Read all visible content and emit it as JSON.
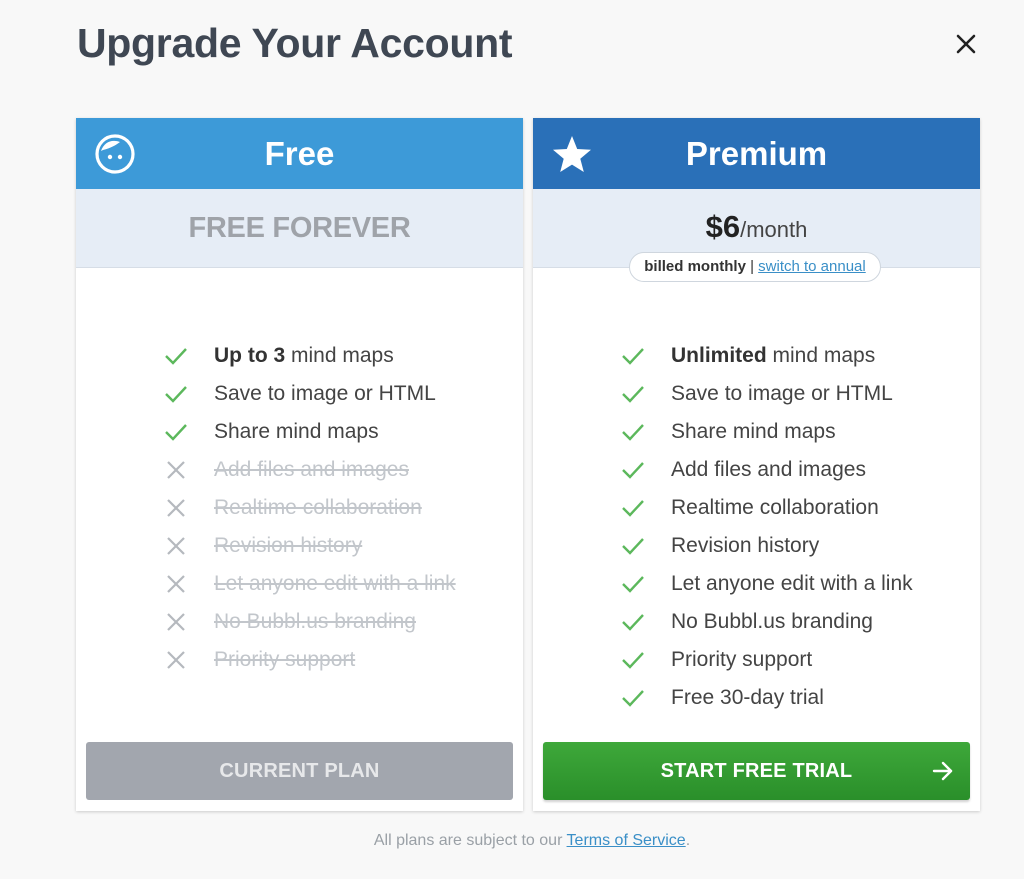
{
  "dialog": {
    "title": "Upgrade Your Account",
    "close_icon": "close-icon"
  },
  "plans": {
    "free": {
      "name": "Free",
      "icon": "face-icon",
      "header_color": "#3d9ad8",
      "price_text": "FREE FOREVER",
      "features": [
        {
          "pre": "",
          "strong": "Up to 3",
          "post": " mind maps",
          "enabled": true
        },
        {
          "pre": "Save to image or HTML",
          "strong": "",
          "post": "",
          "enabled": true
        },
        {
          "pre": "Share mind maps",
          "strong": "",
          "post": "",
          "enabled": true
        },
        {
          "pre": "Add files and images",
          "strong": "",
          "post": "",
          "enabled": false
        },
        {
          "pre": "Realtime collaboration",
          "strong": "",
          "post": "",
          "enabled": false
        },
        {
          "pre": "Revision history",
          "strong": "",
          "post": "",
          "enabled": false
        },
        {
          "pre": "Let anyone edit with a link",
          "strong": "",
          "post": "",
          "enabled": false
        },
        {
          "pre": "No Bubbl.us branding",
          "strong": "",
          "post": "",
          "enabled": false
        },
        {
          "pre": "Priority support",
          "strong": "",
          "post": "",
          "enabled": false
        }
      ],
      "button_label": "CURRENT PLAN"
    },
    "premium": {
      "name": "Premium",
      "icon": "star-icon",
      "header_color": "#2a70b8",
      "price_amount": "$6",
      "price_period": "/month",
      "billing_current": "billed monthly",
      "billing_separator": " | ",
      "billing_switch": "switch to annual",
      "features": [
        {
          "pre": "",
          "strong": "Unlimited",
          "post": " mind maps",
          "enabled": true
        },
        {
          "pre": "Save to image or HTML",
          "strong": "",
          "post": "",
          "enabled": true
        },
        {
          "pre": "Share mind maps",
          "strong": "",
          "post": "",
          "enabled": true
        },
        {
          "pre": "Add files and images",
          "strong": "",
          "post": "",
          "enabled": true
        },
        {
          "pre": "Realtime collaboration",
          "strong": "",
          "post": "",
          "enabled": true
        },
        {
          "pre": "Revision history",
          "strong": "",
          "post": "",
          "enabled": true
        },
        {
          "pre": "Let anyone edit with a link",
          "strong": "",
          "post": "",
          "enabled": true
        },
        {
          "pre": "No Bubbl.us branding",
          "strong": "",
          "post": "",
          "enabled": true
        },
        {
          "pre": "Priority support",
          "strong": "",
          "post": "",
          "enabled": true
        },
        {
          "pre": "Free 30-day trial",
          "strong": "",
          "post": "",
          "enabled": true
        }
      ],
      "button_label": "START FREE TRIAL",
      "button_icon": "arrow-right-icon",
      "button_color": "#35a033"
    }
  },
  "footer": {
    "text": "All plans are subject to our ",
    "link": "Terms of Service",
    "end": "."
  },
  "colors": {
    "check": "#5cb85c",
    "cross": "#b5b9be"
  }
}
